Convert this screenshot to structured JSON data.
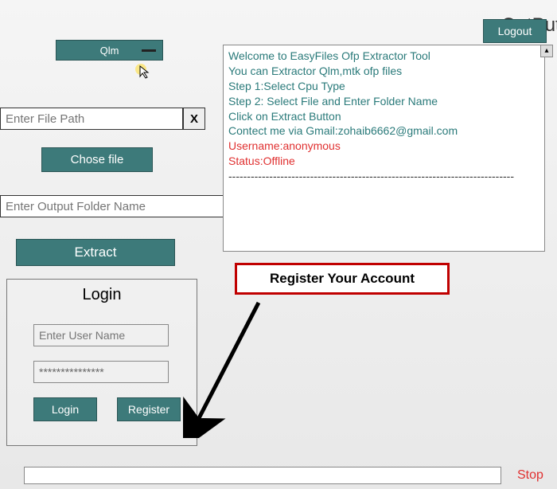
{
  "cpu": {
    "selected": "Qlm"
  },
  "inputs": {
    "file_path_placeholder": "Enter File Path",
    "clear_label": "X",
    "chose_file_label": "Chose file",
    "output_folder_placeholder": "Enter Output Folder Name",
    "extract_label": "Extract"
  },
  "login": {
    "title": "Login",
    "username_placeholder": "Enter User Name",
    "password_value": "***************",
    "login_label": "Login",
    "register_label": "Register"
  },
  "output": {
    "header": "OutPut",
    "logout_label": "Logout",
    "lines": {
      "l1": "Welcome to EasyFiles Ofp Extractor Tool",
      "l2": "You can Extractor Qlm,mtk ofp files",
      "l3": "Step 1:Select Cpu Type",
      "l4": "Step 2: Select File and Enter Folder Name",
      "l5": "Click on Extract Button",
      "l6": "Contect me via Gmail:zohaib6662@gmail.com",
      "l7": "Username:anonymous",
      "l8": "Status:Offline",
      "dash": "-----------------------------------------------------------------------------"
    }
  },
  "annotation": {
    "text": "Register Your Account"
  },
  "bottom": {
    "stop_label": "Stop"
  },
  "colors": {
    "teal": "#3d7a7a",
    "red": "#e03030",
    "annotation_border": "#c00000"
  }
}
